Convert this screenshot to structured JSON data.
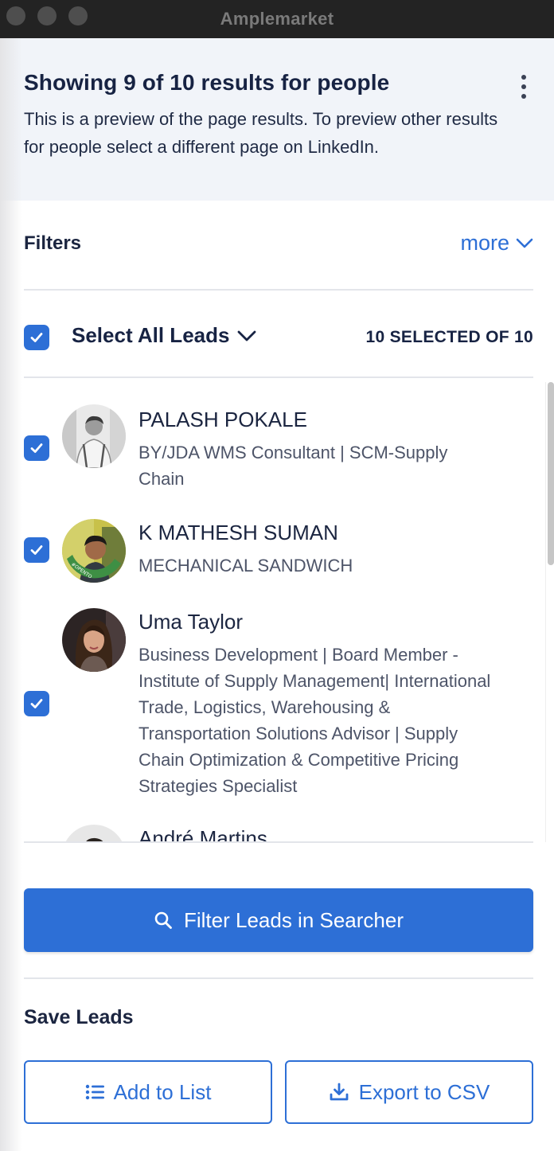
{
  "window": {
    "title": "Amplemarket"
  },
  "header": {
    "title": "Showing 9 of 10 results for people",
    "description": "This is a preview of the page results. To preview other results for people select a different page on LinkedIn."
  },
  "filters": {
    "label": "Filters",
    "more_label": "more"
  },
  "selection": {
    "select_all_label": "Select All Leads",
    "count_label": "10 SELECTED OF 10",
    "all_checked": true
  },
  "leads": [
    {
      "name": "PALASH POKALE",
      "title": "BY/JDA WMS Consultant | SCM-Supply Chain",
      "checked": true,
      "avatar_icon": "person-photo-icon"
    },
    {
      "name": "K MATHESH SUMAN",
      "title": "MECHANICAL SANDWICH",
      "checked": true,
      "avatar_icon": "person-photo-opentowork-icon",
      "avatar_badge": "#OPENTOWORK"
    },
    {
      "name": "Uma Taylor",
      "title": "Business Development | Board Member - Institute of Supply Management| International Trade, Logistics, Warehousing & Transportation Solutions Advisor | Supply Chain Optimization & Competitive Pricing Strategies Specialist",
      "checked": true,
      "avatar_icon": "person-photo-icon"
    },
    {
      "name": "André Martins",
      "title": "",
      "checked": true,
      "avatar_icon": "person-photo-icon"
    }
  ],
  "actions": {
    "filter_button": "Filter Leads in Searcher",
    "save_label": "Save Leads",
    "add_to_list": "Add to List",
    "export_csv": "Export to CSV"
  },
  "colors": {
    "accent": "#2d6fd6",
    "header_bg": "#f1f4f9",
    "text_dark": "#172343",
    "text_muted": "#4d5468"
  }
}
